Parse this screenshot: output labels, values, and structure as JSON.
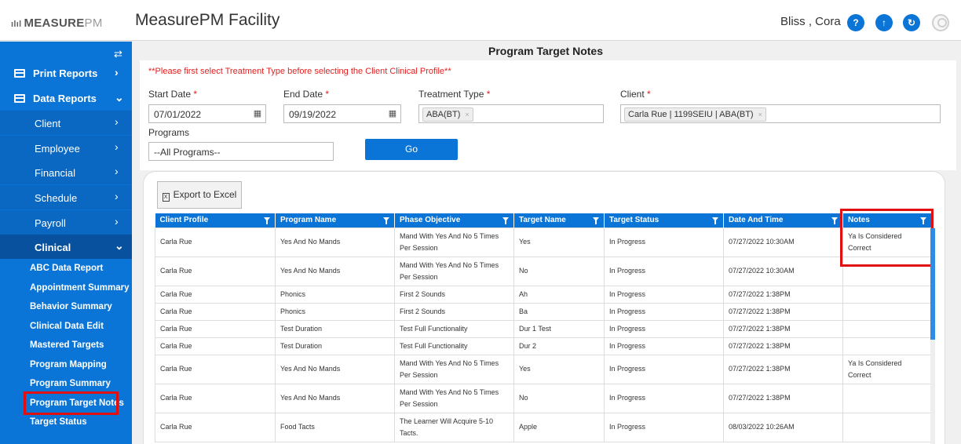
{
  "header": {
    "logo_mark": "ılıl",
    "logo_main": "MEASURE",
    "logo_pm": "PM",
    "app_title": "MeasurePM Facility",
    "user": "Bliss , Cora",
    "icons": [
      "help-icon",
      "upload-icon",
      "refresh-icon",
      "user-avatar-icon"
    ],
    "icon_glyphs": [
      "?",
      "↑",
      "↻"
    ]
  },
  "sidebar": {
    "toggle_glyph": "⇄",
    "sections": [
      {
        "label": "Print Reports"
      },
      {
        "label": "Data Reports"
      }
    ],
    "submenus": [
      "Client",
      "Employee",
      "Financial",
      "Schedule",
      "Payroll",
      "Clinical"
    ],
    "links": [
      "ABC Data Report",
      "Appointment Summary",
      "Behavior Summary",
      "Clinical Data Edit",
      "Mastered Targets",
      "Program Mapping",
      "Program Summary",
      "Program Target Notes",
      "Target Status"
    ],
    "chevron_right": "›",
    "chevron_down": "⌄"
  },
  "page": {
    "title": "Program Target Notes",
    "warning": "**Please first select Treatment Type before selecting the Client Clinical Profile**"
  },
  "form": {
    "start_date_label": "Start Date",
    "start_date": "07/01/2022",
    "end_date_label": "End Date",
    "end_date": "09/19/2022",
    "treatment_type_label": "Treatment Type",
    "treatment_type": "ABA(BT)",
    "client_label": "Client",
    "client": "Carla Rue | 1199SEIU | ABA(BT)",
    "programs_label": "Programs",
    "programs": "--All Programs--",
    "required_mark": "*",
    "go_label": "Go",
    "calendar_glyph": "▦",
    "tag_remove": "×"
  },
  "grid": {
    "export_label": "Export to Excel",
    "export_icon": "X",
    "columns": [
      "Client Profile",
      "Program Name",
      "Phase Objective",
      "Target Name",
      "Target Status",
      "Date And Time",
      "Notes"
    ],
    "rows": [
      [
        "Carla Rue",
        "Yes And No Mands",
        "Mand With Yes And No 5 Times Per Session",
        "Yes",
        "In Progress",
        "07/27/2022 10:30AM",
        "Ya Is Considered Correct"
      ],
      [
        "Carla Rue",
        "Yes And No Mands",
        "Mand With Yes And No 5 Times Per Session",
        "No",
        "In Progress",
        "07/27/2022 10:30AM",
        ""
      ],
      [
        "Carla Rue",
        "Phonics",
        "First 2 Sounds",
        "Ah",
        "In Progress",
        "07/27/2022 1:38PM",
        ""
      ],
      [
        "Carla Rue",
        "Phonics",
        "First 2 Sounds",
        "Ba",
        "In Progress",
        "07/27/2022 1:38PM",
        ""
      ],
      [
        "Carla Rue",
        "Test Duration",
        "Test Full Functionality",
        "Dur 1 Test",
        "In Progress",
        "07/27/2022 1:38PM",
        ""
      ],
      [
        "Carla Rue",
        "Test Duration",
        "Test Full Functionality",
        "Dur 2",
        "In Progress",
        "07/27/2022 1:38PM",
        ""
      ],
      [
        "Carla Rue",
        "Yes And No Mands",
        "Mand With Yes And No 5 Times Per Session",
        "Yes",
        "In Progress",
        "07/27/2022 1:38PM",
        "Ya Is Considered Correct"
      ],
      [
        "Carla Rue",
        "Yes And No Mands",
        "Mand With Yes And No 5 Times Per Session",
        "No",
        "In Progress",
        "07/27/2022 1:38PM",
        ""
      ],
      [
        "Carla Rue",
        "Food Tacts",
        "The Learner Will Acquire 5-10 Tacts.",
        "Apple",
        "In Progress",
        "08/03/2022 10:26AM",
        ""
      ]
    ]
  },
  "colors": {
    "accent": "#0a75d6",
    "highlight": "#e01010",
    "warning": "#e32020"
  }
}
